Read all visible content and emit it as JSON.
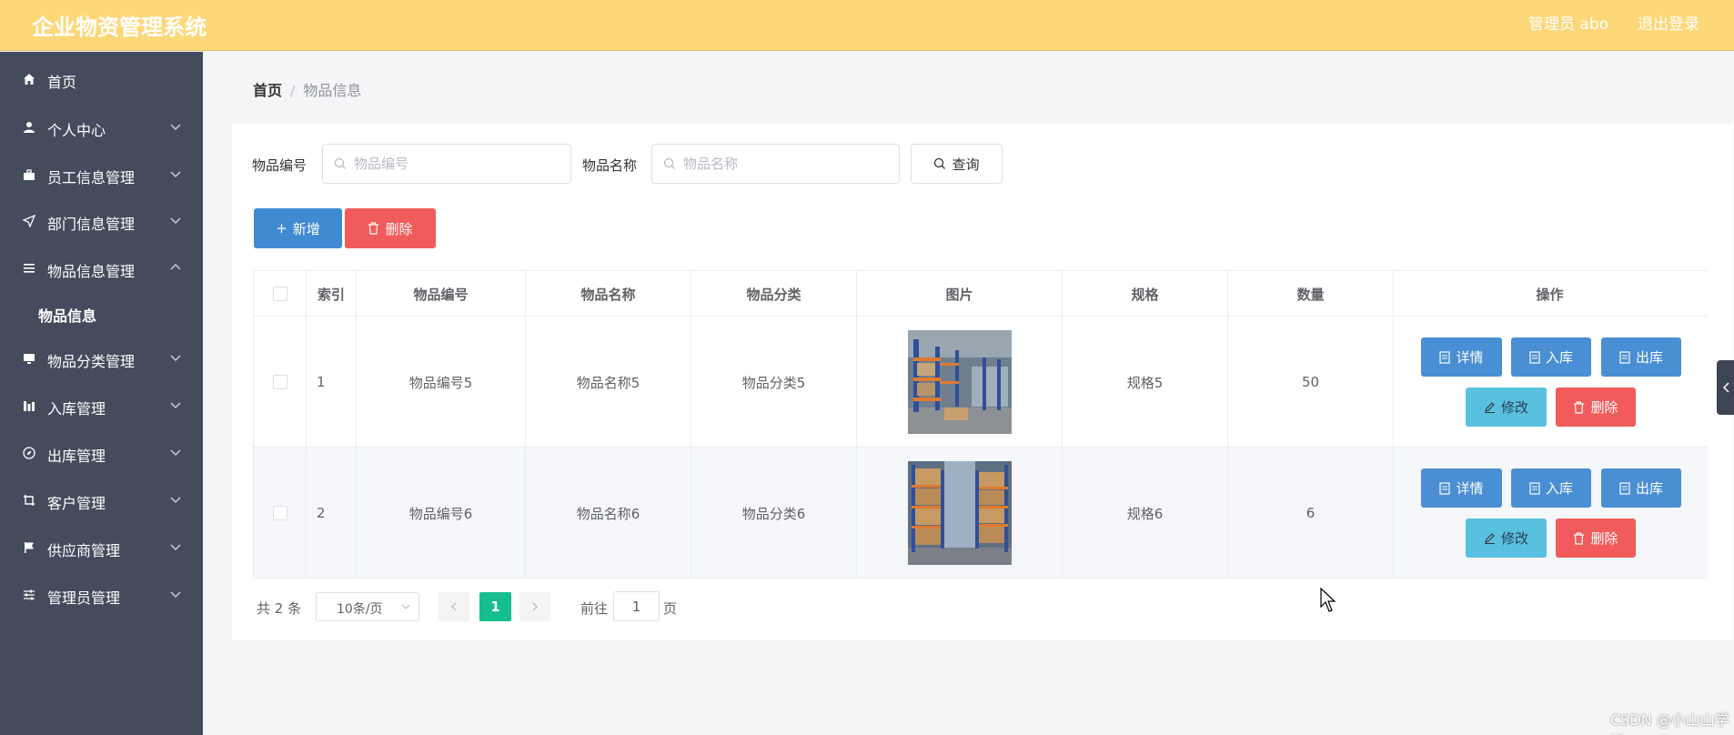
{
  "header": {
    "title": "企业物资管理系统",
    "admin": "管理员 abo",
    "logout": "退出登录",
    "bg_color": "#fdd879"
  },
  "sidebar": {
    "items": [
      {
        "label": "首页",
        "icon": "home-icon"
      },
      {
        "label": "个人中心",
        "icon": "user-icon"
      },
      {
        "label": "员工信息管理",
        "icon": "suitcase-icon"
      },
      {
        "label": "部门信息管理",
        "icon": "send-icon"
      },
      {
        "label": "物品信息管理",
        "icon": "list-icon"
      },
      {
        "label": "物品信息",
        "icon": ""
      },
      {
        "label": "物品分类管理",
        "icon": "monitor-icon"
      },
      {
        "label": "入库管理",
        "icon": "bar-chart-icon"
      },
      {
        "label": "出库管理",
        "icon": "compass-icon"
      },
      {
        "label": "客户管理",
        "icon": "crop-icon"
      },
      {
        "label": "供应商管理",
        "icon": "flag-icon"
      },
      {
        "label": "管理员管理",
        "icon": "sliders-icon"
      }
    ]
  },
  "breadcrumb": {
    "home": "首页",
    "separator": "/",
    "current": "物品信息"
  },
  "search": {
    "code_label": "物品编号",
    "code_placeholder": "物品编号",
    "name_label": "物品名称",
    "name_placeholder": "物品名称",
    "query": "查询"
  },
  "actions": {
    "add": "新增",
    "delete": "删除"
  },
  "table": {
    "columns": [
      "索引",
      "物品编号",
      "物品名称",
      "物品分类",
      "图片",
      "规格",
      "数量",
      "操作"
    ],
    "rows": [
      {
        "index": "1",
        "code": "物品编号5",
        "name": "物品名称5",
        "category": "物品分类5",
        "spec": "规格5",
        "qty": "50"
      },
      {
        "index": "2",
        "code": "物品编号6",
        "name": "物品名称6",
        "category": "物品分类6",
        "spec": "规格6",
        "qty": "6"
      }
    ],
    "row_actions": {
      "detail": "详情",
      "in": "入库",
      "out": "出库",
      "edit": "修改",
      "delete": "删除"
    }
  },
  "pagination": {
    "total": "共 2 条",
    "page_size": "10条/页",
    "current": "1",
    "goto_label": "前往",
    "goto_value": "1",
    "page_suffix": "页"
  },
  "watermark": "CSDN @小山山学姐"
}
